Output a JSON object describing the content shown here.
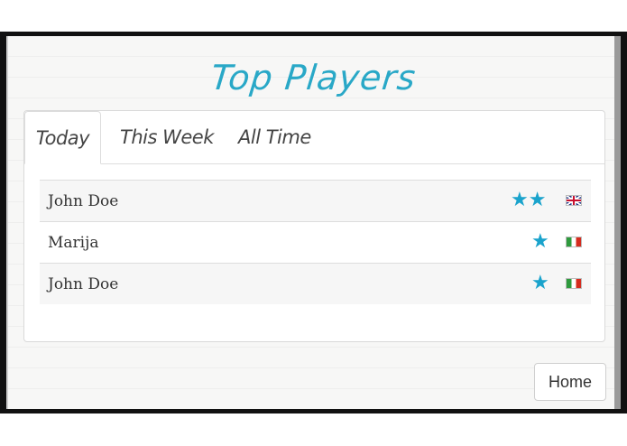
{
  "page": {
    "title": "Top Players"
  },
  "tabs": [
    {
      "label": "Today",
      "active": true
    },
    {
      "label": "This Week",
      "active": false
    },
    {
      "label": "All Time",
      "active": false
    }
  ],
  "players": [
    {
      "name": "John Doe",
      "stars": "★★",
      "star_count": 2,
      "flag": "uk-flag-icon"
    },
    {
      "name": "Marija",
      "stars": "★",
      "star_count": 1,
      "flag": "italy-flag-icon"
    },
    {
      "name": "John Doe",
      "stars": "★",
      "star_count": 1,
      "flag": "italy-flag-icon"
    }
  ],
  "buttons": {
    "home_label": "Home"
  },
  "colors": {
    "accent": "#1aa3cc",
    "title": "#29a8c7"
  }
}
